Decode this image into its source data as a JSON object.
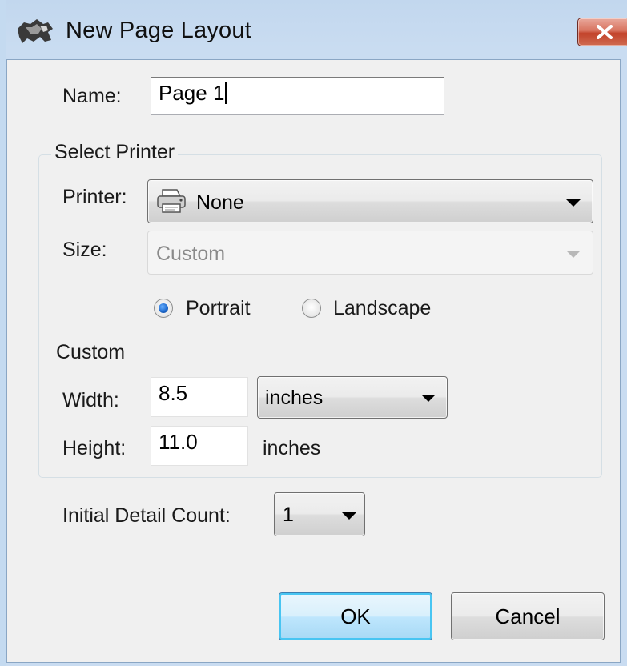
{
  "window": {
    "title": "New Page Layout",
    "close_label": "X"
  },
  "name_field": {
    "label": "Name:",
    "value": "Page 1"
  },
  "select_printer": {
    "group_title": "Select Printer",
    "printer_label": "Printer:",
    "printer_value": "None",
    "size_label": "Size:",
    "size_value": "Custom",
    "size_enabled": false
  },
  "orientation": {
    "portrait_label": "Portrait",
    "landscape_label": "Landscape",
    "selected": "Portrait"
  },
  "custom": {
    "section_label": "Custom",
    "width_label": "Width:",
    "width_value": "8.5",
    "width_unit": "inches",
    "height_label": "Height:",
    "height_value": "11.0",
    "height_unit": "inches"
  },
  "detail": {
    "label": "Initial Detail Count:",
    "value": "1"
  },
  "buttons": {
    "ok": "OK",
    "cancel": "Cancel"
  },
  "icons": {
    "app": "rhino-app-icon",
    "close": "close-icon",
    "printer": "printer-icon"
  },
  "colors": {
    "titlebar": "#c4daf0",
    "dialog_bg": "#f0f0f0",
    "close_button": "#c2432b",
    "radio_selected": "#1f6bd0"
  }
}
